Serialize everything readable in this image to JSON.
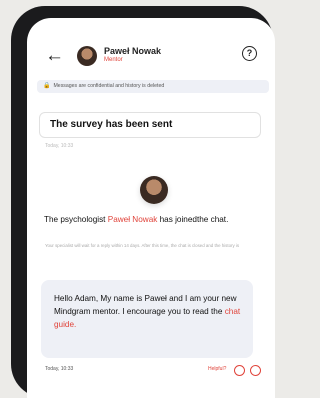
{
  "header": {
    "back_icon": "arrow-left-icon",
    "name": "Paweł Nowak",
    "status": "Mentor",
    "help_icon": "question-circle-icon",
    "help_symbol": "?"
  },
  "notice": {
    "icon": "lock-icon",
    "icon_symbol": "🔒",
    "text": "Messages are confidential and history is deleted"
  },
  "survey_card": {
    "text": "The survey has been sent"
  },
  "timestamps": {
    "first": "Today, 10:33",
    "second": "Today, 10:33"
  },
  "joined": {
    "prefix": "The psychologist",
    "name": "Paweł Nowak",
    "suffix": "has joinedthe chat."
  },
  "note": "Your specialist will wait for a reply within 14 days. After this time, the chat is closed and the history is",
  "message": {
    "text": "Hello Adam, My name is Paweł and I am your new Mindgram mentor. I encourage you to read the",
    "link": "chat guide."
  },
  "footer": {
    "helpful_label": "Helpful?"
  },
  "colors": {
    "accent": "#e0433a",
    "bubble": "#eef0f6"
  }
}
